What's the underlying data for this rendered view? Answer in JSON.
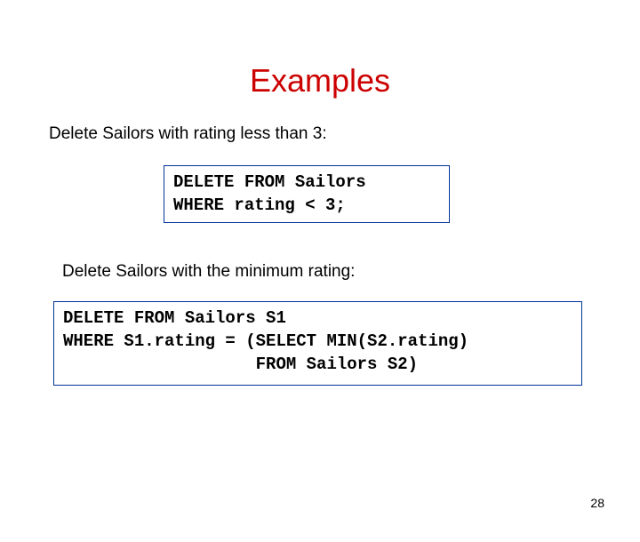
{
  "title": "Examples",
  "desc1": "Delete Sailors with rating less than 3:",
  "code1": "DELETE FROM Sailors\nWHERE rating < 3;",
  "desc2": "Delete Sailors with the minimum rating:",
  "code2": "DELETE FROM Sailors S1\nWHERE S1.rating = (SELECT MIN(S2.rating)\n                   FROM Sailors S2)",
  "pagenum": "28"
}
